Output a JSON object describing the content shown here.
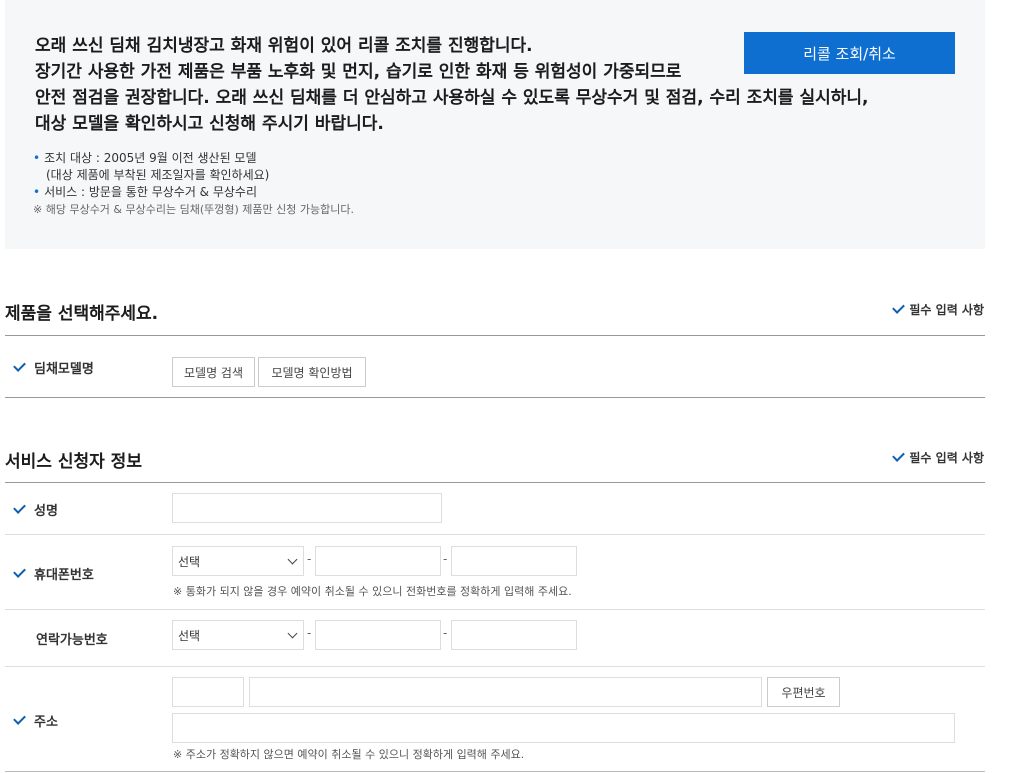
{
  "notice": {
    "lines": [
      "오래 쓰신 딤채 김치냉장고 화재 위험이 있어 리콜 조치를 진행합니다.",
      "장기간 사용한 가전 제품은 부품 노후화 및 먼지, 습기로 인한 화재 등 위험성이 가중되므로",
      "안전 점검을 권장합니다. 오래 쓰신 딤채를 더 안심하고 사용하실 수 있도록 무상수거 및 점검, 수리 조치를 실시하니,",
      "대상 모델을 확인하시고 신청해 주시기 바랍니다."
    ],
    "recall_button": "리콜 조회/취소",
    "target": "조치 대상 : 2005년 9월 이전 생산된 모델",
    "target_sub": "(대상 제품에 부착된 제조일자를 확인하세요)",
    "service": "서비스 : 방문을 통한 무상수거 & 무상수리",
    "note": "※ 해당 무상수거 & 무상수리는 딤채(뚜껑형) 제품만 신청 가능합니다."
  },
  "product_section": {
    "title": "제품을 선택해주세요.",
    "required_label": "필수 입력 사항",
    "model_label": "딤채모델명",
    "search_button": "모델명 검색",
    "howto_button": "모델명 확인방법"
  },
  "applicant_section": {
    "title": "서비스 신청자 정보",
    "required_label": "필수 입력 사항",
    "name_label": "성명",
    "name_value": "",
    "mobile_label": "휴대폰번호",
    "mobile_select": "선택",
    "mobile_mid": "",
    "mobile_last": "",
    "mobile_hint": "※ 통화가 되지 않을 경우 예약이 취소될 수 있으니 전화번호를 정확하게 입력해 주세요.",
    "contact_label": "연락가능번호",
    "contact_select": "선택",
    "contact_mid": "",
    "contact_last": "",
    "address_label": "주소",
    "postcode_value": "",
    "address_value": "",
    "address_detail_value": "",
    "postcode_button": "우편번호",
    "address_hint": "※ 주소가 정확하지 않으면 예약이 취소될 수 있으니 정확하게 입력해 주세요.",
    "separator": "-"
  },
  "colors": {
    "accent": "#0f6fd1",
    "check": "#0f5fb0",
    "notice_bg": "#f6f7f9"
  }
}
